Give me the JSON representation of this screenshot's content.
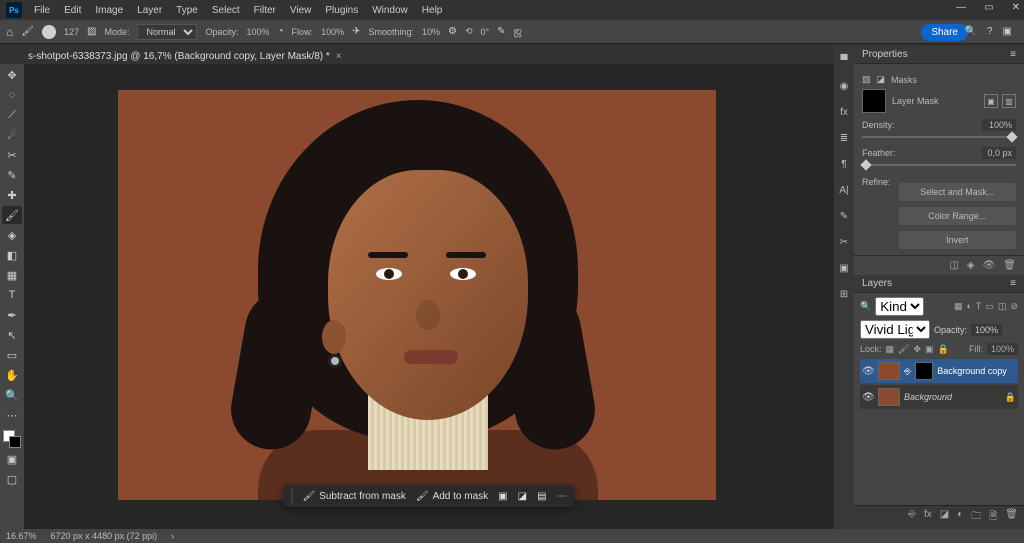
{
  "menubar": [
    "File",
    "Edit",
    "Image",
    "Layer",
    "Type",
    "Select",
    "Filter",
    "View",
    "Plugins",
    "Window",
    "Help"
  ],
  "optbar": {
    "brush_size": "127",
    "mode_label": "Mode:",
    "mode": "Normal",
    "opacity_label": "Opacity:",
    "opacity": "100%",
    "flow_label": "Flow:",
    "flow": "100%",
    "smoothing_label": "Smoothing:",
    "smoothing": "10%",
    "angle_label": "⟲",
    "angle": "0°"
  },
  "share": "Share",
  "tab": {
    "title": "s-shotpot-6338373.jpg @ 16,7% (Background copy, Layer Mask/8) *"
  },
  "ctxbar": {
    "subtract": "Subtract from mask",
    "add": "Add to mask"
  },
  "properties": {
    "title": "Properties",
    "masks_label": "Masks",
    "layer_mask": "Layer Mask",
    "density_label": "Density:",
    "density": "100%",
    "feather_label": "Feather:",
    "feather": "0,0 px",
    "refine_label": "Refine:",
    "select_mask": "Select and Mask...",
    "color_range": "Color Range...",
    "invert": "Invert"
  },
  "layers": {
    "title": "Layers",
    "kind": "Kind",
    "blend": "Vivid Light",
    "opacity_label": "Opacity:",
    "opacity": "100%",
    "lock_label": "Lock:",
    "fill_label": "Fill:",
    "fill": "100%",
    "items": [
      {
        "name": "Background copy",
        "locked": false,
        "masked": true,
        "italic": false
      },
      {
        "name": "Background",
        "locked": true,
        "masked": false,
        "italic": true
      }
    ]
  },
  "status": {
    "zoom": "16.67%",
    "dims": "6720 px x 4480 px (72 ppi)"
  }
}
